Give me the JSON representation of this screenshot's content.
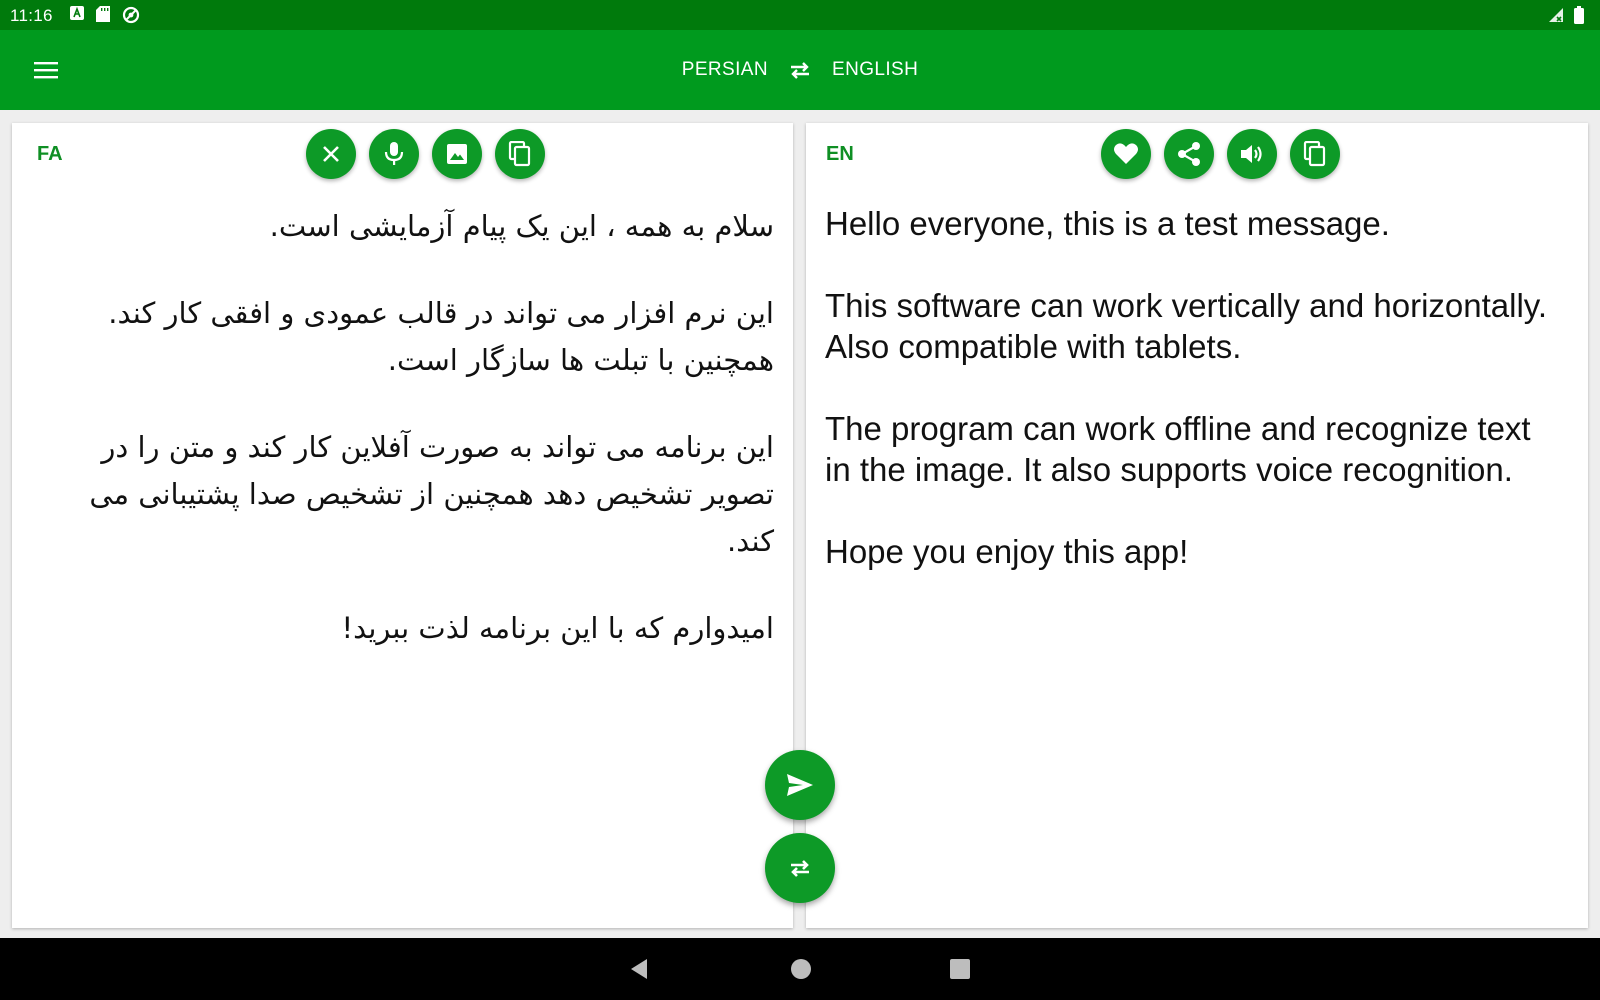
{
  "status": {
    "time": "11:16"
  },
  "header": {
    "source_language": "PERSIAN",
    "target_language": "ENGLISH"
  },
  "source_panel": {
    "lang_code": "FA",
    "buttons": [
      "close-icon",
      "mic-icon",
      "image-icon",
      "copy-icon"
    ],
    "paragraphs": [
      "سلام به همه ، این یک پیام آزمایشی است.",
      "این نرم افزار می تواند در قالب عمودی و افقی کار کند. همچنین با تبلت ها سازگار است.",
      "این برنامه می تواند به صورت آفلاین کار کند و متن را در تصویر تشخیص دهد همچنین از تشخیص صدا پشتیبانی می کند.",
      "امیدوارم که با این برنامه لذت ببرید!"
    ]
  },
  "target_panel": {
    "lang_code": "EN",
    "buttons": [
      "heart-icon",
      "share-icon",
      "speaker-icon",
      "copy-icon"
    ],
    "paragraphs": [
      "Hello everyone, this is a test message.",
      "This software can work vertically and horizontally. Also compatible with tablets.",
      "The program can work offline and recognize text in the image. It also supports voice recognition.",
      "Hope you enjoy this app!"
    ]
  },
  "fabs": [
    "send-icon",
    "swap-icon"
  ],
  "colors": {
    "status_bar": "#007a0c",
    "app_bar": "#009a1e",
    "accent": "#0d9a27",
    "lang_code": "#0f8f24"
  }
}
